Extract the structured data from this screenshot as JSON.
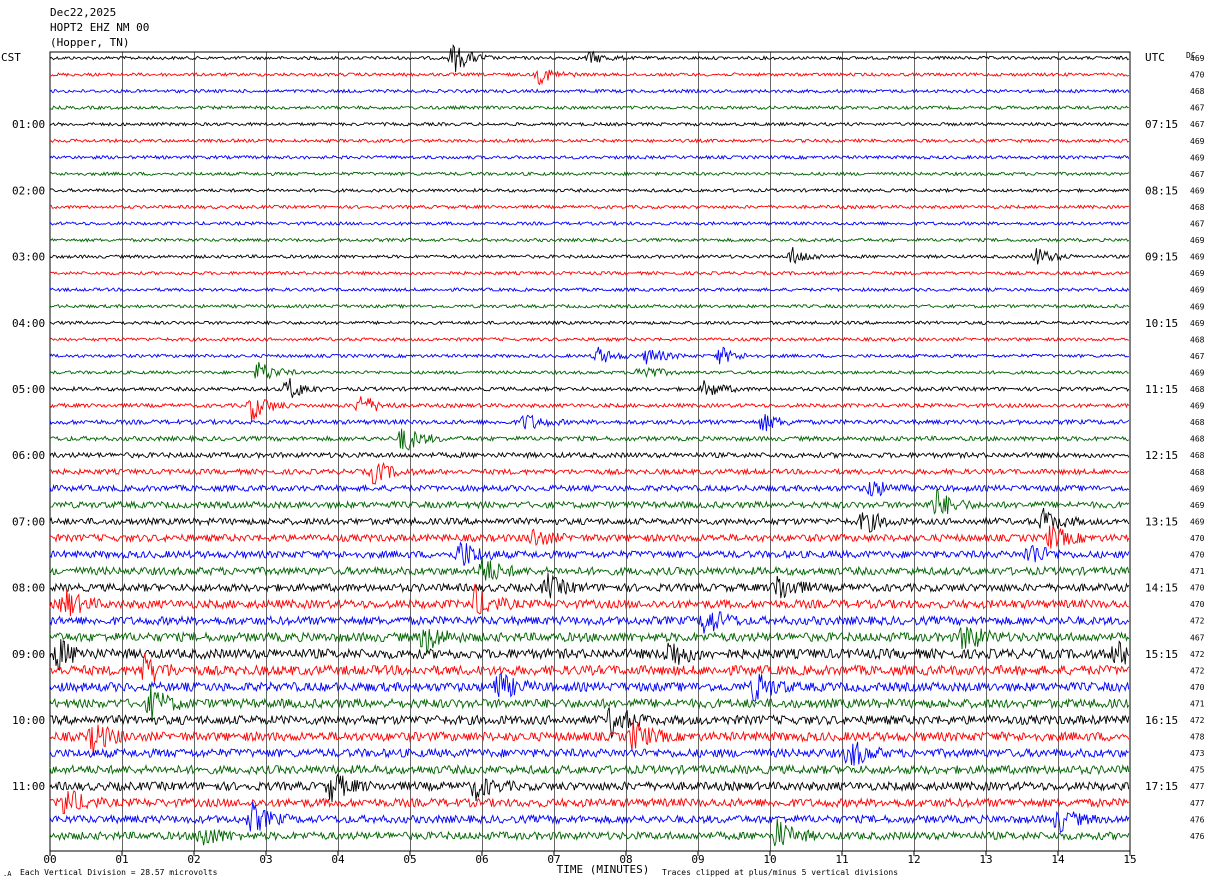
{
  "header": {
    "date": "Dec22,2025",
    "station": "HOPT2 EHZ NM 00",
    "location": "(Hopper, TN)"
  },
  "axes": {
    "left_tz": "CST",
    "right_tz": "UTC",
    "dc_label": "DC",
    "xlabel": "TIME (MINUTES)"
  },
  "footer": {
    "scale_note": "Each Vertical Division =   28.57 microvolts",
    "clip_note": "Traces clipped at plus/minus 5 vertical divisions"
  },
  "colors": {
    "trace_cycle": [
      "#000000",
      "#ff0000",
      "#0000ff",
      "#006400"
    ],
    "grid": "#000000"
  },
  "chart_data": {
    "type": "line",
    "title": "HOPT2 EHZ NM 00",
    "xlabel": "TIME (MINUTES)",
    "xlim": [
      0,
      15
    ],
    "x_ticks": [
      "00",
      "01",
      "02",
      "03",
      "04",
      "05",
      "06",
      "07",
      "08",
      "09",
      "10",
      "11",
      "12",
      "13",
      "14",
      "15"
    ],
    "traces_per_hour": 4,
    "minutes_per_trace": 15,
    "n_traces": 48,
    "left_time_labels": [
      "01:00",
      "02:00",
      "03:00",
      "04:00",
      "05:00",
      "06:00",
      "07:00",
      "08:00",
      "09:00",
      "10:00",
      "11:00"
    ],
    "right_time_labels": [
      "07:15",
      "08:15",
      "09:15",
      "10:15",
      "11:15",
      "12:15",
      "13:15",
      "14:15",
      "15:15",
      "16:15",
      "17:15"
    ],
    "dc_offsets": [
      469,
      470,
      468,
      467,
      467,
      469,
      469,
      467,
      469,
      468,
      467,
      469,
      469,
      469,
      469,
      469,
      469,
      468,
      467,
      469,
      468,
      469,
      468,
      468,
      468,
      468,
      469,
      469,
      469,
      470,
      470,
      471,
      470,
      470,
      472,
      467,
      472,
      472,
      470,
      471,
      472,
      478,
      473,
      475,
      477,
      477,
      476,
      476
    ],
    "noise_amplitude": [
      0.5,
      0.5,
      0.5,
      0.5,
      0.5,
      0.5,
      0.5,
      0.5,
      0.5,
      0.5,
      0.5,
      0.5,
      0.5,
      0.5,
      0.5,
      0.5,
      0.5,
      0.5,
      0.5,
      0.5,
      0.6,
      0.6,
      0.7,
      0.7,
      0.8,
      0.8,
      0.9,
      1.0,
      1.0,
      1.1,
      1.1,
      1.2,
      1.2,
      1.3,
      1.3,
      1.4,
      1.5,
      1.5,
      1.4,
      1.4,
      1.4,
      1.4,
      1.3,
      1.3,
      1.3,
      1.3,
      1.2,
      1.2
    ],
    "events": [
      {
        "trace": 0,
        "minute": 5.6,
        "amplitude": 5
      },
      {
        "trace": 0,
        "minute": 7.5,
        "amplitude": 2
      },
      {
        "trace": 1,
        "minute": 6.8,
        "amplitude": 3
      },
      {
        "trace": 12,
        "minute": 10.3,
        "amplitude": 3
      },
      {
        "trace": 12,
        "minute": 13.7,
        "amplitude": 3
      },
      {
        "trace": 18,
        "minute": 7.6,
        "amplitude": 3
      },
      {
        "trace": 18,
        "minute": 8.3,
        "amplitude": 3
      },
      {
        "trace": 18,
        "minute": 9.3,
        "amplitude": 3
      },
      {
        "trace": 19,
        "minute": 2.9,
        "amplitude": 4
      },
      {
        "trace": 19,
        "minute": 8.2,
        "amplitude": 3
      },
      {
        "trace": 20,
        "minute": 3.3,
        "amplitude": 4
      },
      {
        "trace": 20,
        "minute": 9.1,
        "amplitude": 3
      },
      {
        "trace": 21,
        "minute": 2.8,
        "amplitude": 5
      },
      {
        "trace": 21,
        "minute": 4.3,
        "amplitude": 4
      },
      {
        "trace": 22,
        "minute": 6.6,
        "amplitude": 3
      },
      {
        "trace": 22,
        "minute": 9.9,
        "amplitude": 3
      },
      {
        "trace": 23,
        "minute": 4.9,
        "amplitude": 5
      },
      {
        "trace": 25,
        "minute": 4.5,
        "amplitude": 4
      },
      {
        "trace": 26,
        "minute": 11.4,
        "amplitude": 3
      },
      {
        "trace": 27,
        "minute": 12.3,
        "amplitude": 5
      },
      {
        "trace": 28,
        "minute": 11.3,
        "amplitude": 4
      },
      {
        "trace": 28,
        "minute": 13.8,
        "amplitude": 4
      },
      {
        "trace": 29,
        "minute": 6.7,
        "amplitude": 3
      },
      {
        "trace": 29,
        "minute": 13.9,
        "amplitude": 4
      },
      {
        "trace": 30,
        "minute": 5.7,
        "amplitude": 5
      },
      {
        "trace": 30,
        "minute": 13.6,
        "amplitude": 4
      },
      {
        "trace": 31,
        "minute": 6.0,
        "amplitude": 5
      },
      {
        "trace": 32,
        "minute": 6.9,
        "amplitude": 4
      },
      {
        "trace": 32,
        "minute": 10.1,
        "amplitude": 5
      },
      {
        "trace": 33,
        "minute": 0.2,
        "amplitude": 5
      },
      {
        "trace": 33,
        "minute": 5.9,
        "amplitude": 5
      },
      {
        "trace": 34,
        "minute": 9.1,
        "amplitude": 5
      },
      {
        "trace": 35,
        "minute": 5.2,
        "amplitude": 5
      },
      {
        "trace": 35,
        "minute": 12.7,
        "amplitude": 5
      },
      {
        "trace": 36,
        "minute": 0.1,
        "amplitude": 5
      },
      {
        "trace": 36,
        "minute": 8.6,
        "amplitude": 5
      },
      {
        "trace": 36,
        "minute": 14.8,
        "amplitude": 4
      },
      {
        "trace": 37,
        "minute": 1.3,
        "amplitude": 5
      },
      {
        "trace": 38,
        "minute": 6.2,
        "amplitude": 5
      },
      {
        "trace": 38,
        "minute": 9.8,
        "amplitude": 5
      },
      {
        "trace": 39,
        "minute": 1.4,
        "amplitude": 5
      },
      {
        "trace": 40,
        "minute": 7.8,
        "amplitude": 5
      },
      {
        "trace": 41,
        "minute": 0.6,
        "amplitude": 5
      },
      {
        "trace": 41,
        "minute": 8.1,
        "amplitude": 5
      },
      {
        "trace": 42,
        "minute": 11.1,
        "amplitude": 5
      },
      {
        "trace": 44,
        "minute": 3.9,
        "amplitude": 5
      },
      {
        "trace": 44,
        "minute": 5.9,
        "amplitude": 4
      },
      {
        "trace": 45,
        "minute": 0.2,
        "amplitude": 5
      },
      {
        "trace": 46,
        "minute": 2.8,
        "amplitude": 5
      },
      {
        "trace": 46,
        "minute": 14.0,
        "amplitude": 4
      },
      {
        "trace": 47,
        "minute": 10.1,
        "amplitude": 5
      },
      {
        "trace": 47,
        "minute": 2.1,
        "amplitude": 4
      }
    ]
  }
}
